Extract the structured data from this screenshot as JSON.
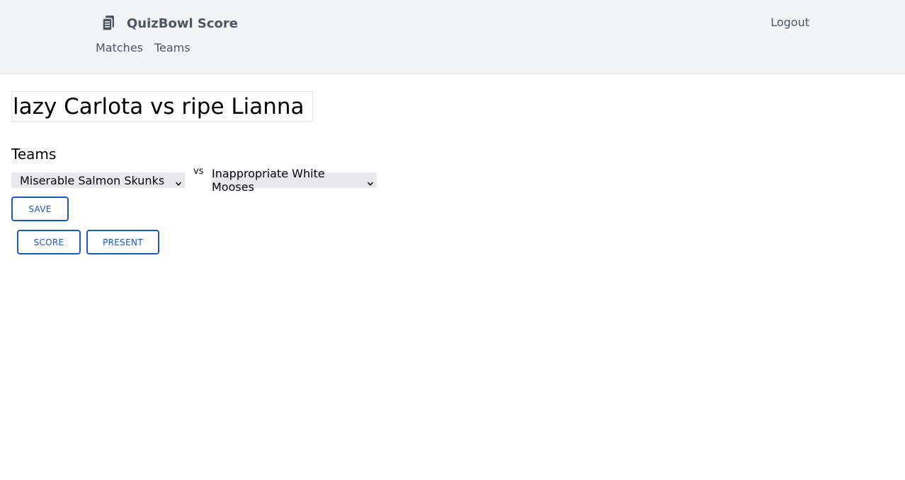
{
  "header": {
    "brand": "QuizBowl Score",
    "logout_label": "Logout",
    "nav": [
      {
        "label": "Matches"
      },
      {
        "label": "Teams"
      }
    ]
  },
  "match": {
    "title_value": "lazy Carlota vs ripe Lianna",
    "teams_label": "Teams",
    "team_a_selected": "Miserable Salmon Skunks",
    "vs_label": "vs",
    "team_b_selected": "Inappropriate White Mooses",
    "save_label": "SAVE",
    "score_label": "SCORE",
    "present_label": "PRESENT"
  },
  "colors": {
    "accent": "#1e55c9",
    "navbar_bg": "#f3f4f6",
    "nav_text": "#4b5563"
  }
}
